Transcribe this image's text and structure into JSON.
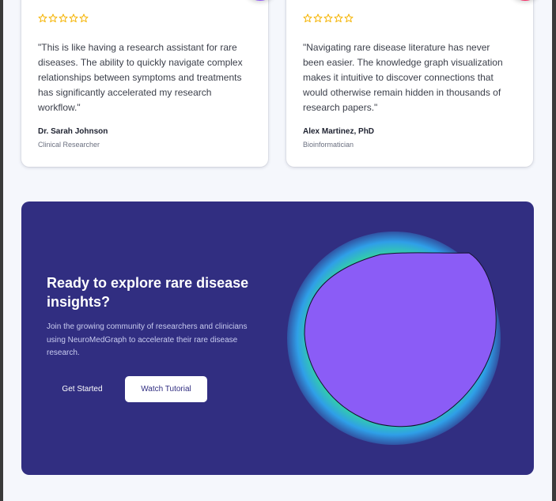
{
  "testimonials": [
    {
      "rating": 5,
      "quote": "\"This is like having a research assistant for rare diseases. The ability to quickly navigate complex relationships between symptoms and treatments has significantly accelerated my research workflow.\"",
      "author": "Dr. Sarah Johnson",
      "role": "Clinical Researcher",
      "avatar_color": "#7c5cf6",
      "avatar_icon": "user-icon"
    },
    {
      "rating": 5,
      "quote": "\"Navigating rare disease literature has never been easier. The knowledge graph visualization makes it intuitive to discover connections that would otherwise remain hidden in thousands of research papers.\"",
      "author": "Alex Martinez, PhD",
      "role": "Bioinformatician",
      "avatar_color": "#f43f6e",
      "avatar_icon": "user-icon"
    }
  ],
  "cta": {
    "title": "Ready to explore rare disease insights?",
    "description": "Join the growing community of researchers and clinicians using NeuroMedGraph to accelerate their rare disease research.",
    "primary_button": "Get Started",
    "secondary_button": "Watch Tutorial",
    "background_color": "#312e81",
    "blob_color": "#8b5cf6",
    "glow_colors": [
      "#34d3a2",
      "#2f9fe8"
    ]
  },
  "colors": {
    "star": "#f5b301",
    "page_background": "#f5f7fc"
  }
}
